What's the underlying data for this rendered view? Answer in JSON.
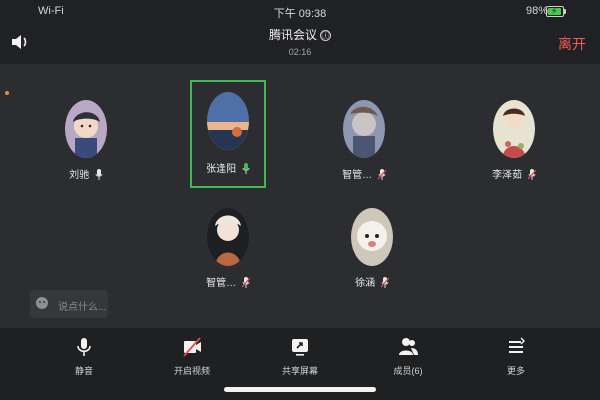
{
  "status_bar": {
    "network": "Wi-Fi",
    "time": "下午 09:38",
    "battery": "98%"
  },
  "header": {
    "title": "腾讯会议",
    "info_icon": "ⓘ",
    "duration": "02:16",
    "leave_label": "离开"
  },
  "participants": [
    {
      "name": "刘驰",
      "mic": "on",
      "active": false
    },
    {
      "name": "张逢阳",
      "mic": "speaking",
      "active": true
    },
    {
      "name": "智管…",
      "mic": "muted",
      "active": false
    },
    {
      "name": "李泽茹",
      "mic": "muted",
      "active": false
    },
    {
      "name": "智管…",
      "mic": "muted",
      "active": false
    },
    {
      "name": "徐涵",
      "mic": "muted",
      "active": false
    }
  ],
  "chat": {
    "placeholder": "说点什么..."
  },
  "toolbar": {
    "mute_label": "静音",
    "video_label": "开启视频",
    "share_label": "共享屏幕",
    "members_label": "成员(6)",
    "more_label": "更多"
  },
  "colors": {
    "accent_green": "#3fb950",
    "leave_red": "#f25c54",
    "muted_red": "#e5484d"
  }
}
